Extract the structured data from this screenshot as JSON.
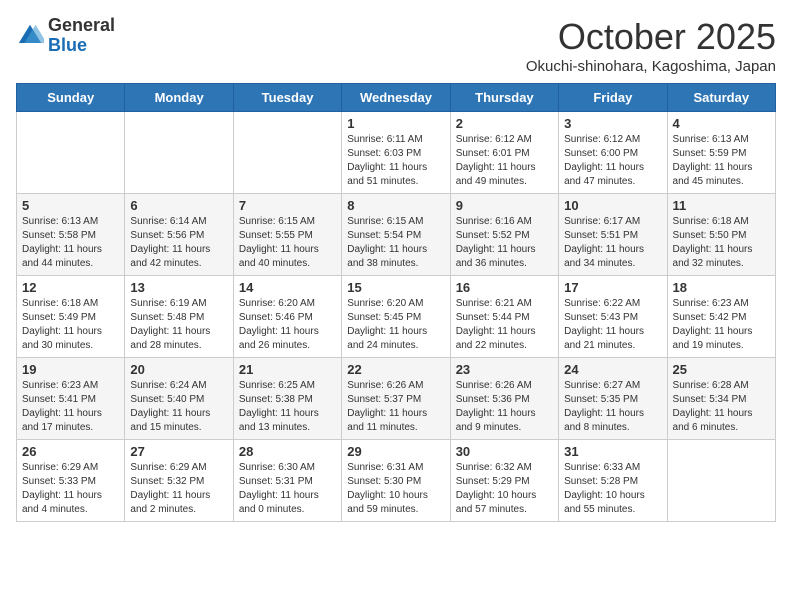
{
  "header": {
    "logo_general": "General",
    "logo_blue": "Blue",
    "month_title": "October 2025",
    "location": "Okuchi-shinohara, Kagoshima, Japan"
  },
  "days_of_week": [
    "Sunday",
    "Monday",
    "Tuesday",
    "Wednesday",
    "Thursday",
    "Friday",
    "Saturday"
  ],
  "weeks": [
    [
      {
        "day": "",
        "info": ""
      },
      {
        "day": "",
        "info": ""
      },
      {
        "day": "",
        "info": ""
      },
      {
        "day": "1",
        "info": "Sunrise: 6:11 AM\nSunset: 6:03 PM\nDaylight: 11 hours\nand 51 minutes."
      },
      {
        "day": "2",
        "info": "Sunrise: 6:12 AM\nSunset: 6:01 PM\nDaylight: 11 hours\nand 49 minutes."
      },
      {
        "day": "3",
        "info": "Sunrise: 6:12 AM\nSunset: 6:00 PM\nDaylight: 11 hours\nand 47 minutes."
      },
      {
        "day": "4",
        "info": "Sunrise: 6:13 AM\nSunset: 5:59 PM\nDaylight: 11 hours\nand 45 minutes."
      }
    ],
    [
      {
        "day": "5",
        "info": "Sunrise: 6:13 AM\nSunset: 5:58 PM\nDaylight: 11 hours\nand 44 minutes."
      },
      {
        "day": "6",
        "info": "Sunrise: 6:14 AM\nSunset: 5:56 PM\nDaylight: 11 hours\nand 42 minutes."
      },
      {
        "day": "7",
        "info": "Sunrise: 6:15 AM\nSunset: 5:55 PM\nDaylight: 11 hours\nand 40 minutes."
      },
      {
        "day": "8",
        "info": "Sunrise: 6:15 AM\nSunset: 5:54 PM\nDaylight: 11 hours\nand 38 minutes."
      },
      {
        "day": "9",
        "info": "Sunrise: 6:16 AM\nSunset: 5:52 PM\nDaylight: 11 hours\nand 36 minutes."
      },
      {
        "day": "10",
        "info": "Sunrise: 6:17 AM\nSunset: 5:51 PM\nDaylight: 11 hours\nand 34 minutes."
      },
      {
        "day": "11",
        "info": "Sunrise: 6:18 AM\nSunset: 5:50 PM\nDaylight: 11 hours\nand 32 minutes."
      }
    ],
    [
      {
        "day": "12",
        "info": "Sunrise: 6:18 AM\nSunset: 5:49 PM\nDaylight: 11 hours\nand 30 minutes."
      },
      {
        "day": "13",
        "info": "Sunrise: 6:19 AM\nSunset: 5:48 PM\nDaylight: 11 hours\nand 28 minutes."
      },
      {
        "day": "14",
        "info": "Sunrise: 6:20 AM\nSunset: 5:46 PM\nDaylight: 11 hours\nand 26 minutes."
      },
      {
        "day": "15",
        "info": "Sunrise: 6:20 AM\nSunset: 5:45 PM\nDaylight: 11 hours\nand 24 minutes."
      },
      {
        "day": "16",
        "info": "Sunrise: 6:21 AM\nSunset: 5:44 PM\nDaylight: 11 hours\nand 22 minutes."
      },
      {
        "day": "17",
        "info": "Sunrise: 6:22 AM\nSunset: 5:43 PM\nDaylight: 11 hours\nand 21 minutes."
      },
      {
        "day": "18",
        "info": "Sunrise: 6:23 AM\nSunset: 5:42 PM\nDaylight: 11 hours\nand 19 minutes."
      }
    ],
    [
      {
        "day": "19",
        "info": "Sunrise: 6:23 AM\nSunset: 5:41 PM\nDaylight: 11 hours\nand 17 minutes."
      },
      {
        "day": "20",
        "info": "Sunrise: 6:24 AM\nSunset: 5:40 PM\nDaylight: 11 hours\nand 15 minutes."
      },
      {
        "day": "21",
        "info": "Sunrise: 6:25 AM\nSunset: 5:38 PM\nDaylight: 11 hours\nand 13 minutes."
      },
      {
        "day": "22",
        "info": "Sunrise: 6:26 AM\nSunset: 5:37 PM\nDaylight: 11 hours\nand 11 minutes."
      },
      {
        "day": "23",
        "info": "Sunrise: 6:26 AM\nSunset: 5:36 PM\nDaylight: 11 hours\nand 9 minutes."
      },
      {
        "day": "24",
        "info": "Sunrise: 6:27 AM\nSunset: 5:35 PM\nDaylight: 11 hours\nand 8 minutes."
      },
      {
        "day": "25",
        "info": "Sunrise: 6:28 AM\nSunset: 5:34 PM\nDaylight: 11 hours\nand 6 minutes."
      }
    ],
    [
      {
        "day": "26",
        "info": "Sunrise: 6:29 AM\nSunset: 5:33 PM\nDaylight: 11 hours\nand 4 minutes."
      },
      {
        "day": "27",
        "info": "Sunrise: 6:29 AM\nSunset: 5:32 PM\nDaylight: 11 hours\nand 2 minutes."
      },
      {
        "day": "28",
        "info": "Sunrise: 6:30 AM\nSunset: 5:31 PM\nDaylight: 11 hours\nand 0 minutes."
      },
      {
        "day": "29",
        "info": "Sunrise: 6:31 AM\nSunset: 5:30 PM\nDaylight: 10 hours\nand 59 minutes."
      },
      {
        "day": "30",
        "info": "Sunrise: 6:32 AM\nSunset: 5:29 PM\nDaylight: 10 hours\nand 57 minutes."
      },
      {
        "day": "31",
        "info": "Sunrise: 6:33 AM\nSunset: 5:28 PM\nDaylight: 10 hours\nand 55 minutes."
      },
      {
        "day": "",
        "info": ""
      }
    ]
  ]
}
